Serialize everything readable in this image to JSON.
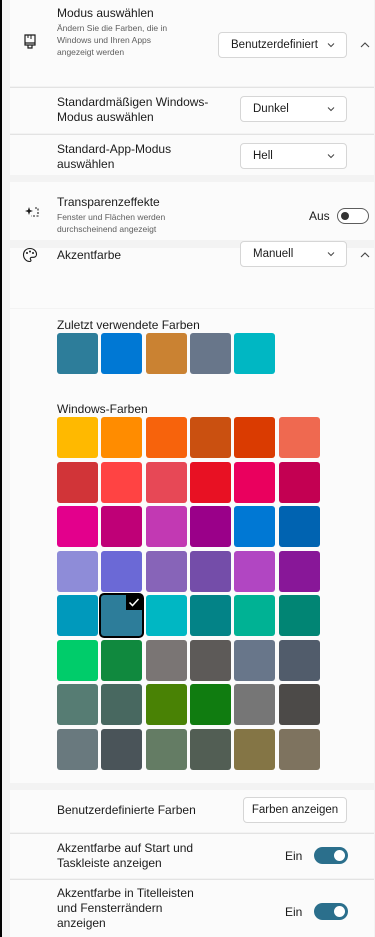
{
  "mode": {
    "title": "Modus auswählen",
    "subtitle_lines": [
      "Ändern Sie die Farben, die in",
      "Windows und Ihren Apps",
      "angezeigt werden"
    ],
    "value": "Benutzerdefiniert",
    "icon": "brush-icon"
  },
  "windows_mode": {
    "title_lines": [
      "Standardmäßigen Windows-",
      "Modus auswählen"
    ],
    "value": "Dunkel"
  },
  "app_mode": {
    "title_lines": [
      "Standard-App-Modus",
      "auswählen"
    ],
    "value": "Hell"
  },
  "transparency": {
    "title": "Transparenzeffekte",
    "subtitle_lines": [
      "Fenster und Flächen werden",
      "durchscheinend angezeigt"
    ],
    "state": "Aus",
    "on": false,
    "icon": "transparency-icon"
  },
  "accent": {
    "title": "Akzentfarbe",
    "value": "Manuell",
    "icon": "palette-icon"
  },
  "recent_colors": {
    "label": "Zuletzt verwendete Farben",
    "colors": [
      "#2d7d9a",
      "#0078d4",
      "#ca8232",
      "#68768a",
      "#00b7c3"
    ]
  },
  "windows_colors": {
    "label": "Windows-Farben",
    "selected": 25,
    "colors": [
      "#ffb900",
      "#ff8c00",
      "#f7630c",
      "#ca5010",
      "#da3b01",
      "#ef6950",
      "#d13438",
      "#ff4343",
      "#e74856",
      "#e81123",
      "#ea005e",
      "#c30052",
      "#e3008c",
      "#bf0077",
      "#c239b3",
      "#9a0089",
      "#0078d4",
      "#0063b1",
      "#8e8cd8",
      "#6b69d6",
      "#8764b8",
      "#744da9",
      "#b146c2",
      "#881798",
      "#0099bc",
      "#2d7d9a",
      "#00b7c3",
      "#038387",
      "#00b294",
      "#018574",
      "#00cc6a",
      "#10893e",
      "#7a7574",
      "#5d5a58",
      "#68768a",
      "#515c6b",
      "#567c73",
      "#486860",
      "#498205",
      "#107c10",
      "#767676",
      "#4c4a48",
      "#69797e",
      "#4a5459",
      "#647c64",
      "#525e54",
      "#847545",
      "#7e735f"
    ]
  },
  "custom_colors": {
    "label": "Benutzerdefinierte Farben",
    "button": "Farben anzeigen"
  },
  "accent_start": {
    "title_lines": [
      "Akzentfarbe auf Start und",
      "Taskleiste anzeigen"
    ],
    "state": "Ein",
    "on": true
  },
  "accent_title": {
    "title_lines": [
      "Akzentfarbe in Titelleisten",
      "und Fensterrändern",
      "anzeigen"
    ],
    "state": "Ein",
    "on": true
  }
}
